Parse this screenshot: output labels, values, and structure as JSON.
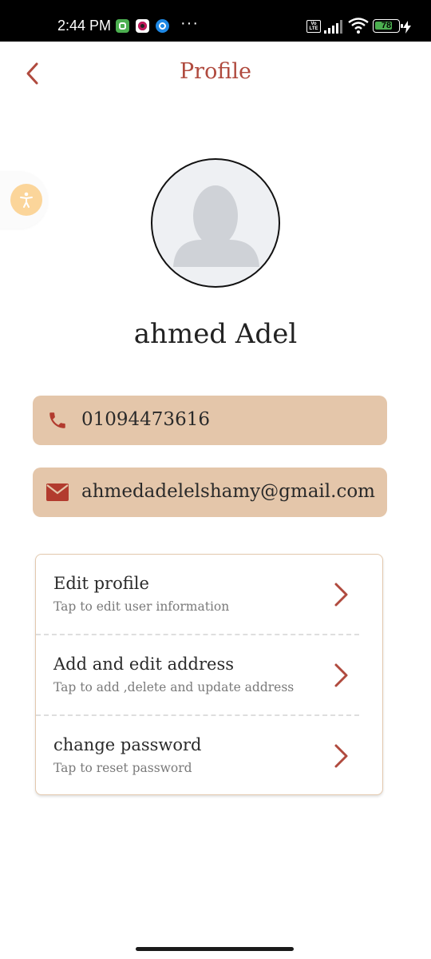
{
  "status_bar": {
    "time": "2:44 PM",
    "overflow": "···",
    "network_badge": "Vo LTE",
    "battery_level": "78",
    "battery_fraction": 0.78
  },
  "header": {
    "title": "Profile",
    "back_icon": "chevron-left-icon"
  },
  "user": {
    "name": "ahmed Adel",
    "phone": "01094473616",
    "email": "ahmedadelelshamy@gmail.com"
  },
  "menu": {
    "items": [
      {
        "title": "Edit profile",
        "subtitle": "Tap to edit user information"
      },
      {
        "title": "Add and edit address",
        "subtitle": "Tap to add ,delete and update address"
      },
      {
        "title": "change password",
        "subtitle": "Tap to reset password"
      }
    ]
  },
  "colors": {
    "accent": "#b04a3e",
    "card_bg": "#e4c6aa",
    "a11y_bg": "#fbd59a"
  }
}
